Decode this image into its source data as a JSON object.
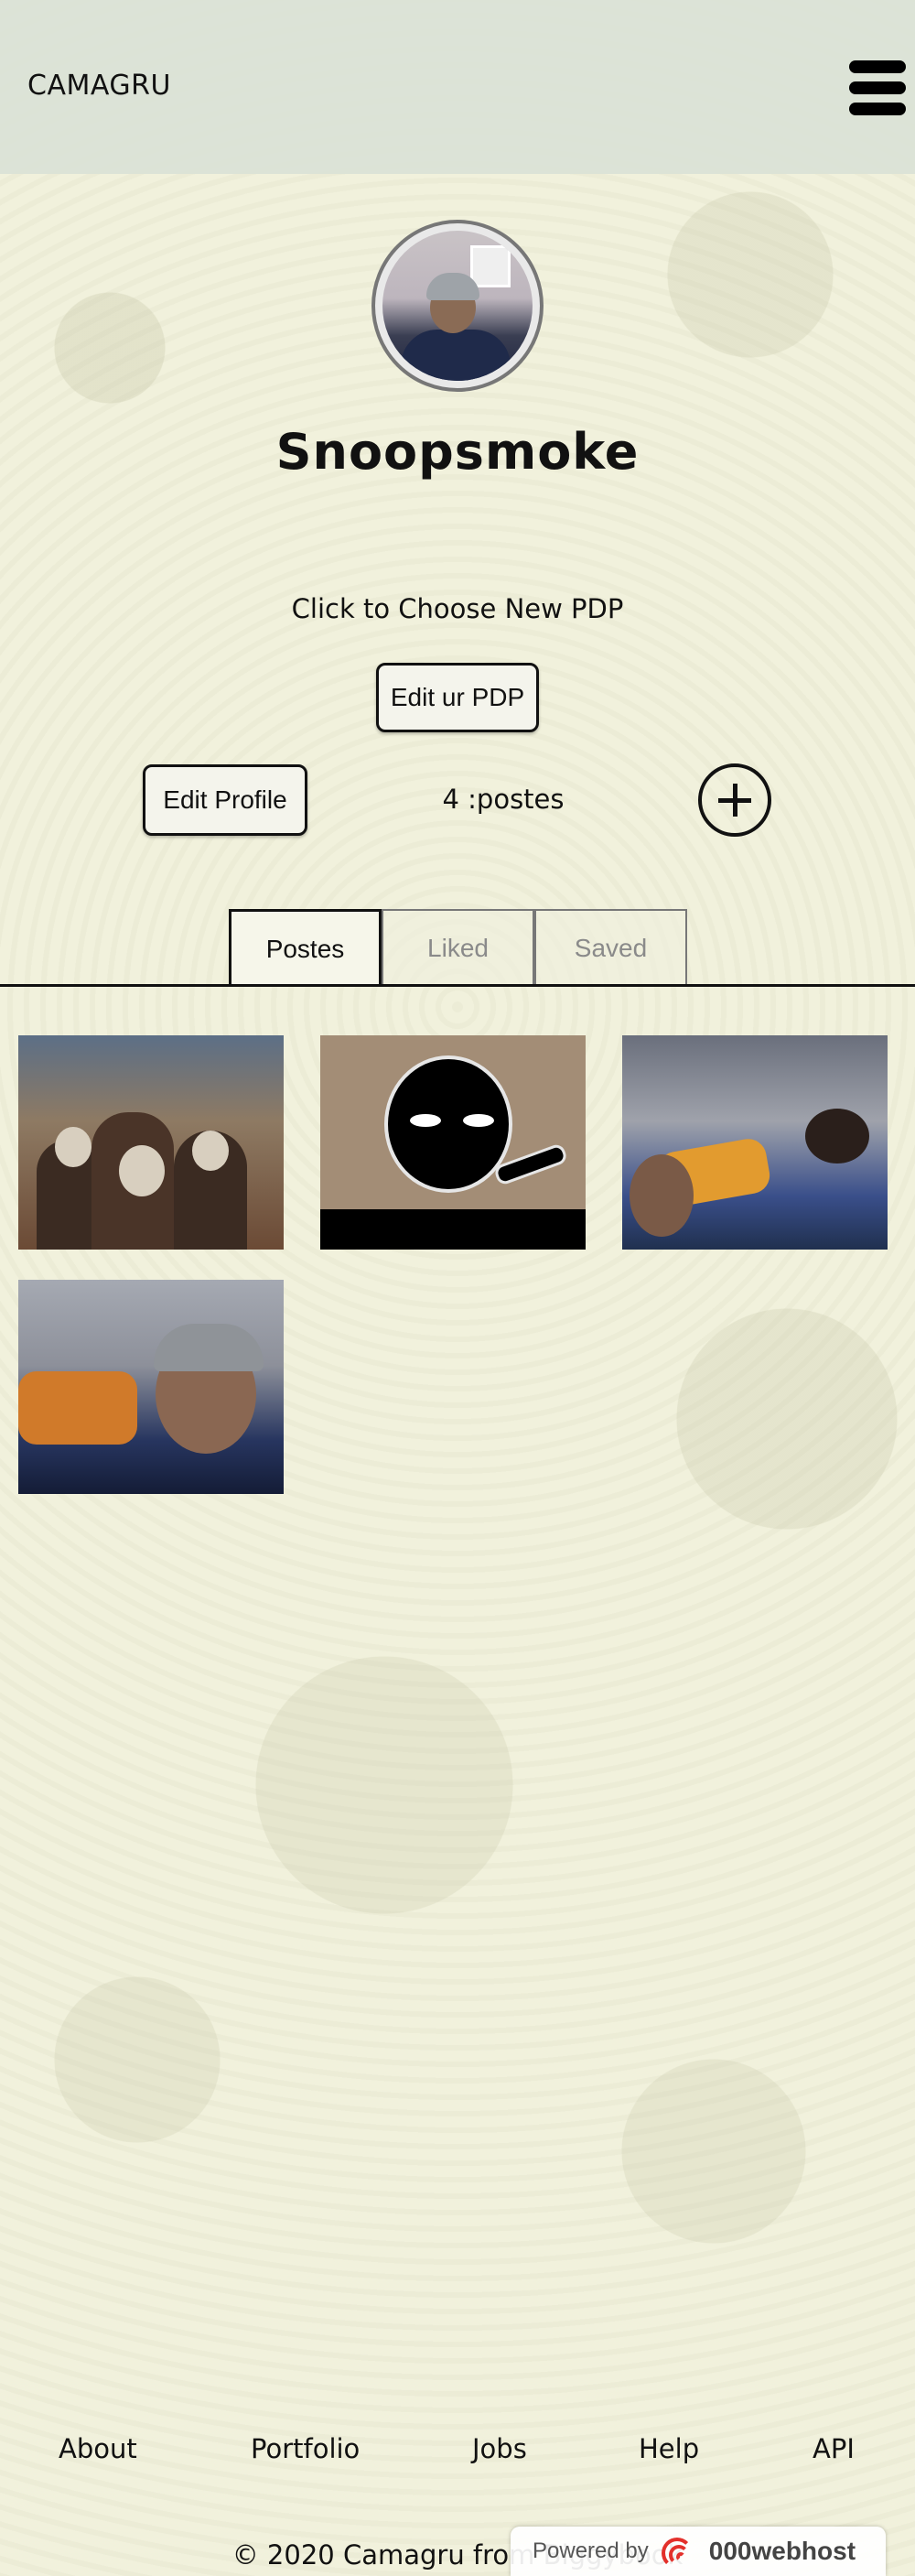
{
  "header": {
    "brand": "CAMAGRU",
    "menu_icon": "hamburger-menu-icon"
  },
  "profile": {
    "username": "Snoopsmoke",
    "choose_pdp_label": "Click to Choose New PDP",
    "edit_pdp_label": "Edit ur PDP",
    "edit_profile_label": "Edit Profile",
    "post_count": "4 :postes",
    "add_post_icon": "plus-circle-icon"
  },
  "tabs": [
    {
      "label": "Postes",
      "active": true
    },
    {
      "label": "Liked",
      "active": false
    },
    {
      "label": "Saved",
      "active": false
    }
  ],
  "posts_count_visible": 4,
  "footer": {
    "links": [
      "About",
      "Portfolio",
      "Jobs",
      "Help",
      "API"
    ],
    "copyright": "© 2020 Camagru from Biggybook"
  },
  "webhost_badge": {
    "powered_label": "Powered by",
    "brand": "000webhost"
  },
  "colors": {
    "background": "#f1f1dc",
    "header": "#dae2d6",
    "text": "#111111",
    "inactive_tab": "#8a8a8a",
    "webhost_red": "#e3302b"
  }
}
